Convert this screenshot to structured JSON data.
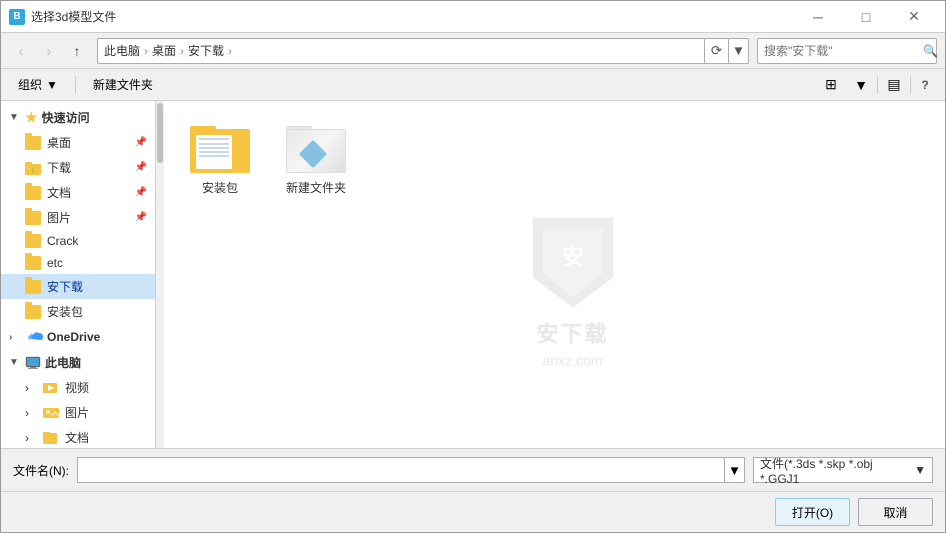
{
  "window": {
    "title": "选择3d模型文件",
    "icon": "B"
  },
  "titlebar": {
    "minimize": "─",
    "maximize": "□",
    "close": "✕"
  },
  "nav": {
    "back": "‹",
    "forward": "›",
    "up": "↑",
    "refresh": "⟳",
    "dropdown": "▼"
  },
  "address": {
    "parts": [
      "此电脑",
      "桌面",
      "安下载"
    ],
    "search_placeholder": "搜索\"安下载\""
  },
  "toolbar2": {
    "organize": "组织",
    "organize_dropdown": "▼",
    "new_folder": "新建文件夹"
  },
  "view": {
    "view_icon": "⊞",
    "view_dropdown": "▼",
    "details_icon": "▤",
    "help_icon": "?"
  },
  "sidebar": {
    "quick_access": {
      "label": "快速访问",
      "expanded": true,
      "items": [
        {
          "name": "桌面",
          "pinned": true
        },
        {
          "name": "下载",
          "pinned": true,
          "type": "download"
        },
        {
          "name": "文档",
          "pinned": true
        },
        {
          "name": "图片",
          "pinned": true
        },
        {
          "name": "Crack",
          "pinned": false
        },
        {
          "name": "etc",
          "pinned": false
        },
        {
          "name": "安下载",
          "pinned": false,
          "active": true
        },
        {
          "name": "安装包",
          "pinned": false
        }
      ]
    },
    "onedrive": {
      "label": "OneDrive",
      "expanded": false
    },
    "this_pc": {
      "label": "此电脑",
      "expanded": true,
      "items": [
        {
          "name": "视频"
        },
        {
          "name": "图片"
        },
        {
          "name": "文档"
        }
      ]
    }
  },
  "files": [
    {
      "name": "安装包",
      "type": "folder_with_papers"
    },
    {
      "name": "新建文件夹",
      "type": "new_folder"
    }
  ],
  "watermark": {
    "text": "安下载",
    "url": "anxz.com"
  },
  "bottom": {
    "filename_label": "文件名(N):",
    "filename_value": "",
    "filetype_label": "文件(*.3ds *.skp *.obj *.GGJ1",
    "filetype_dropdown": "▼",
    "open_btn": "打开(O)",
    "cancel_btn": "取消"
  }
}
